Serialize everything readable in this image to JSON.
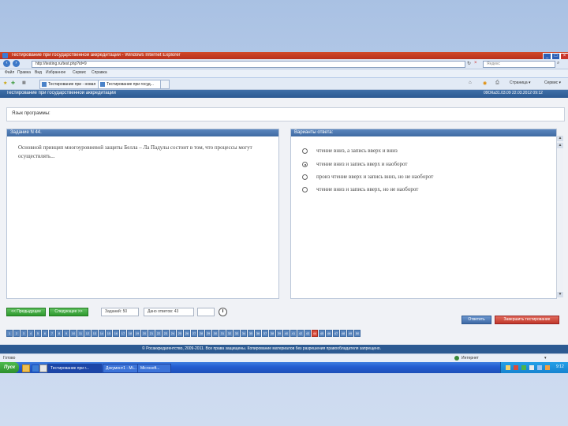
{
  "browser": {
    "title": "Тестирование при государственной аккредитации - Windows Internet Explorer",
    "url": "http://testing.ru/test.php?id=9",
    "search_placeholder": "Яндекс",
    "menu": [
      "Файл",
      "Правка",
      "Вид",
      "Избранное",
      "Сервис",
      "Справка"
    ],
    "tabs": [
      "Тестирование при - новая",
      "Тестирование при госуд..."
    ],
    "status_text": "Готово",
    "zone_text": "Интернет"
  },
  "app": {
    "header_title": "Тестирование при государственной аккредитации",
    "header_right": "09ОКа31.03.09  22.03.2012  09:12",
    "language_label": "Язык программы:",
    "question": {
      "header": "Задание N 44.",
      "text": "Основной принцип многоуровневой защиты Белла – Ла Падулы состоит в том, что процессы могут осуществлять..."
    },
    "answers": {
      "header": "Варианты ответа:",
      "options": [
        {
          "label": "чтение вниз, а запись вверх и вниз",
          "selected": false
        },
        {
          "label": "чтение вниз и запись вверх и наоборот",
          "selected": true
        },
        {
          "label": "произ чтение вверх и запись вниз, но не наоборот",
          "selected": false
        },
        {
          "label": "чтение вниз и запись вверх, но не наоборот",
          "selected": false
        }
      ]
    },
    "nav": {
      "prev_label": "<< Предыдущее",
      "next_label": "Следующее >>",
      "tasks_label": "Заданий: 50",
      "answered_label": "Дано ответов: 43"
    },
    "numbers": [
      "1",
      "2",
      "3",
      "4",
      "5",
      "6",
      "7",
      "8",
      "9",
      "10",
      "11",
      "12",
      "13",
      "14",
      "15",
      "16",
      "17",
      "18",
      "19",
      "20",
      "21",
      "22",
      "23",
      "24",
      "25",
      "26",
      "27",
      "28",
      "29",
      "30",
      "31",
      "32",
      "33",
      "34",
      "35",
      "36",
      "37",
      "38",
      "39",
      "40",
      "41",
      "42",
      "43",
      "44",
      "45",
      "46",
      "47",
      "48",
      "49",
      "50"
    ],
    "current_number": "44",
    "right_buttons": {
      "blue": "Ответить",
      "red": "Завершить тестирование"
    },
    "footer": "© Росаккредагентство, 2009-2011. Все права защищены. Копирование материалов без разрешения правообладателя запрещено."
  },
  "taskbar": {
    "start": "Пуск",
    "tasks": [
      "Тестирование при г...",
      "Документ1 - Mi...",
      "Microsoft..."
    ],
    "clock": "9:12"
  },
  "colors": {
    "title_bar": "#c33b22",
    "app_header": "#3f6aa2",
    "green_button": "#2e9a2e",
    "red_button": "#c0392b",
    "current_number": "#d84c3c"
  }
}
